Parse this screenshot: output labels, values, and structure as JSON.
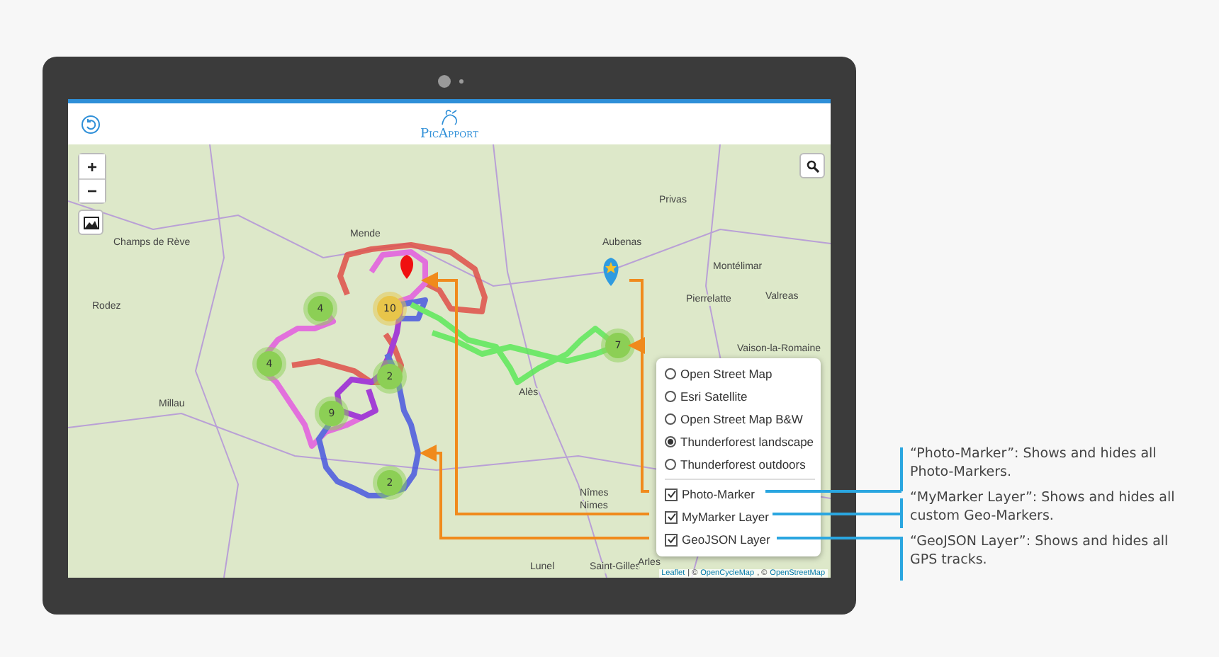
{
  "header": {
    "logo": "PicApport"
  },
  "map": {
    "zoom_in": "+",
    "zoom_out": "−",
    "places": [
      {
        "name": "Privas"
      },
      {
        "name": "Aubenas"
      },
      {
        "name": "Montélimar"
      },
      {
        "name": "Champs de Rève"
      },
      {
        "name": "Mende"
      },
      {
        "name": "Rodez"
      },
      {
        "name": "Pierrelatte"
      },
      {
        "name": "Valreas"
      },
      {
        "name": "Vaison-la-Romaine"
      },
      {
        "name": "Millau"
      },
      {
        "name": "Alès"
      },
      {
        "name": "Nîmes"
      },
      {
        "name": "Nimes"
      },
      {
        "name": "Lunel"
      },
      {
        "name": "Saint-Gilles"
      },
      {
        "name": "Arles"
      }
    ],
    "clusters": [
      {
        "count": "4",
        "color": "#8ccf55"
      },
      {
        "count": "10",
        "color": "#e8c54a"
      },
      {
        "count": "4",
        "color": "#8ccf55"
      },
      {
        "count": "2",
        "color": "#8ccf55"
      },
      {
        "count": "9",
        "color": "#8ccf55"
      },
      {
        "count": "2",
        "color": "#8ccf55"
      },
      {
        "count": "7",
        "color": "#8ccf55"
      }
    ]
  },
  "layer_control": {
    "base_layers": [
      {
        "label": "Open Street Map",
        "selected": false
      },
      {
        "label": "Esri Satellite",
        "selected": false
      },
      {
        "label": "Open Street Map B&W",
        "selected": false
      },
      {
        "label": "Thunderforest landscape",
        "selected": true
      },
      {
        "label": "Thunderforest outdoors",
        "selected": false
      }
    ],
    "overlays": [
      {
        "label": "Photo-Marker",
        "checked": true
      },
      {
        "label": "MyMarker Layer",
        "checked": true
      },
      {
        "label": "GeoJSON Layer",
        "checked": true
      }
    ]
  },
  "attribution": [
    {
      "kind": "link",
      "text": "Leaflet"
    },
    {
      "kind": "text",
      "text": "| ©"
    },
    {
      "kind": "link",
      "text": "OpenCycleMap"
    },
    {
      "kind": "text",
      "text": ", ©"
    },
    {
      "kind": "link",
      "text": "OpenStreetMap"
    }
  ],
  "annotations": [
    {
      "text": "“Photo-Marker”: Shows and hides all Photo-Markers."
    },
    {
      "text": "“MyMarker Layer”: Shows and hides all custom Geo-Markers."
    },
    {
      "text": "“GeoJSON Layer”: Shows and hides all GPS tracks."
    }
  ]
}
